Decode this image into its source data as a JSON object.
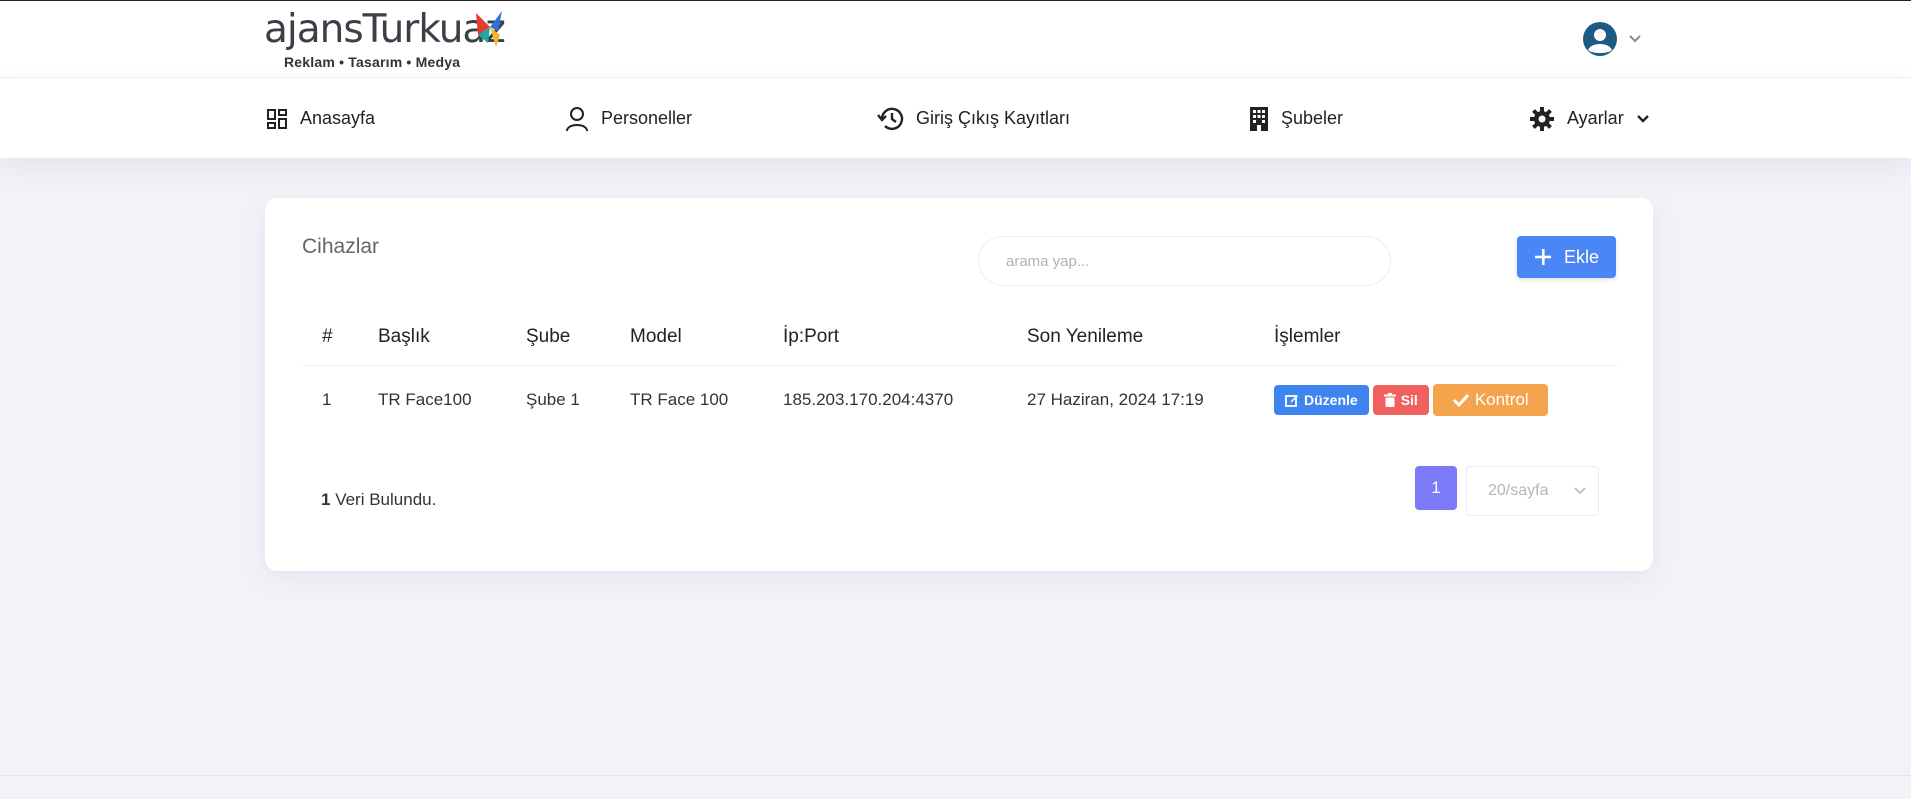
{
  "brand": {
    "name": "ajansTurkuaz",
    "tagline": "Reklam • Tasarım • Medya"
  },
  "user_menu": {
    "avatar_icon": "user-circle-icon",
    "chevron_icon": "chevron-down-icon"
  },
  "nav": {
    "items": [
      {
        "label": "Anasayfa",
        "icon": "dashboard-icon"
      },
      {
        "label": "Personeller",
        "icon": "person-icon"
      },
      {
        "label": "Giriş Çıkış Kayıtları",
        "icon": "history-icon"
      },
      {
        "label": "Şubeler",
        "icon": "building-icon"
      },
      {
        "label": "Ayarlar",
        "icon": "gear-icon"
      }
    ]
  },
  "page": {
    "title": "Cihazlar",
    "search_placeholder": "arama yap...",
    "add_label": "Ekle"
  },
  "table": {
    "headers": [
      "#",
      "Başlık",
      "Şube",
      "Model",
      "İp:Port",
      "Son Yenileme",
      "İşlemler"
    ],
    "rows": [
      {
        "num": "1",
        "baslik": "TR Face100",
        "sube": "Şube 1",
        "model": "TR Face 100",
        "ip_port": "185.203.170.204:4370",
        "son_yenileme": "27 Haziran, 2024 17:19",
        "actions": {
          "edit": "Düzenle",
          "delete": "Sil",
          "control": "Kontrol"
        }
      }
    ]
  },
  "footer": {
    "count_number": "1",
    "count_text": " Veri Bulundu.",
    "current_page": "1",
    "page_size": "20/sayfa"
  },
  "colors": {
    "primary": "#4a86f5",
    "danger": "#f0605f",
    "warning": "#f5a44e",
    "pagination": "#7b7bf7",
    "background": "#f2f2f8"
  }
}
